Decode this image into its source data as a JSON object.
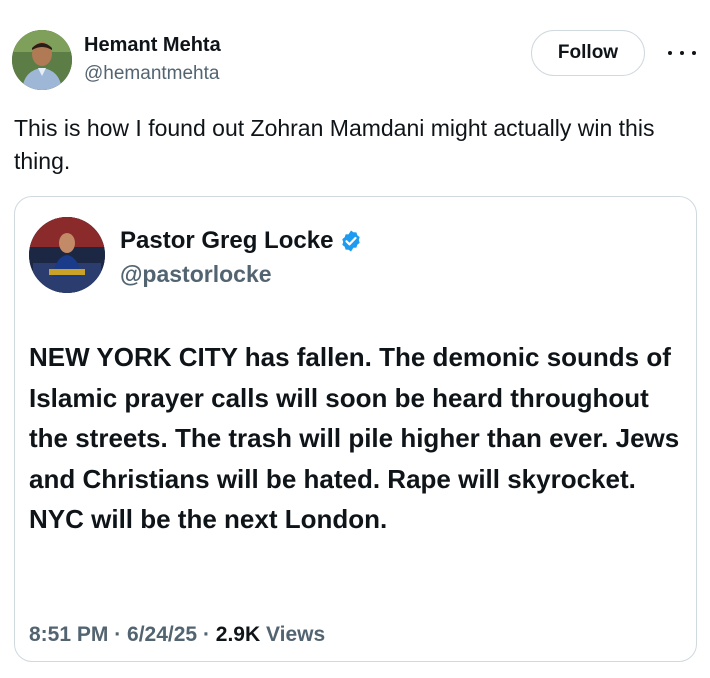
{
  "author": {
    "name": "Hemant Mehta",
    "handle": "@hemantmehta",
    "avatar_icon": "profile-photo"
  },
  "follow_label": "Follow",
  "more_icon": "more-horizontal-icon",
  "tweet_text": "This is how I found out Zohran Mamdani might actually win this thing.",
  "quoted": {
    "name": "Pastor Greg Locke",
    "handle": "@pastorlocke",
    "verified_icon": "verified-badge-icon",
    "verified_color": "#1d9bf0",
    "text": "NEW YORK CITY has fallen. The demonic sounds of Islamic prayer calls will soon be heard throughout the streets. The trash will pile higher than ever. Jews and Christians will be hated. Rape will skyrocket. NYC will be the next London.",
    "time": "8:51 PM",
    "date": "6/24/25",
    "views_count": "2.9K",
    "views_label": "Views"
  },
  "colors": {
    "text_primary": "#0f1419",
    "text_secondary": "#536471",
    "border": "#cfd9de"
  }
}
